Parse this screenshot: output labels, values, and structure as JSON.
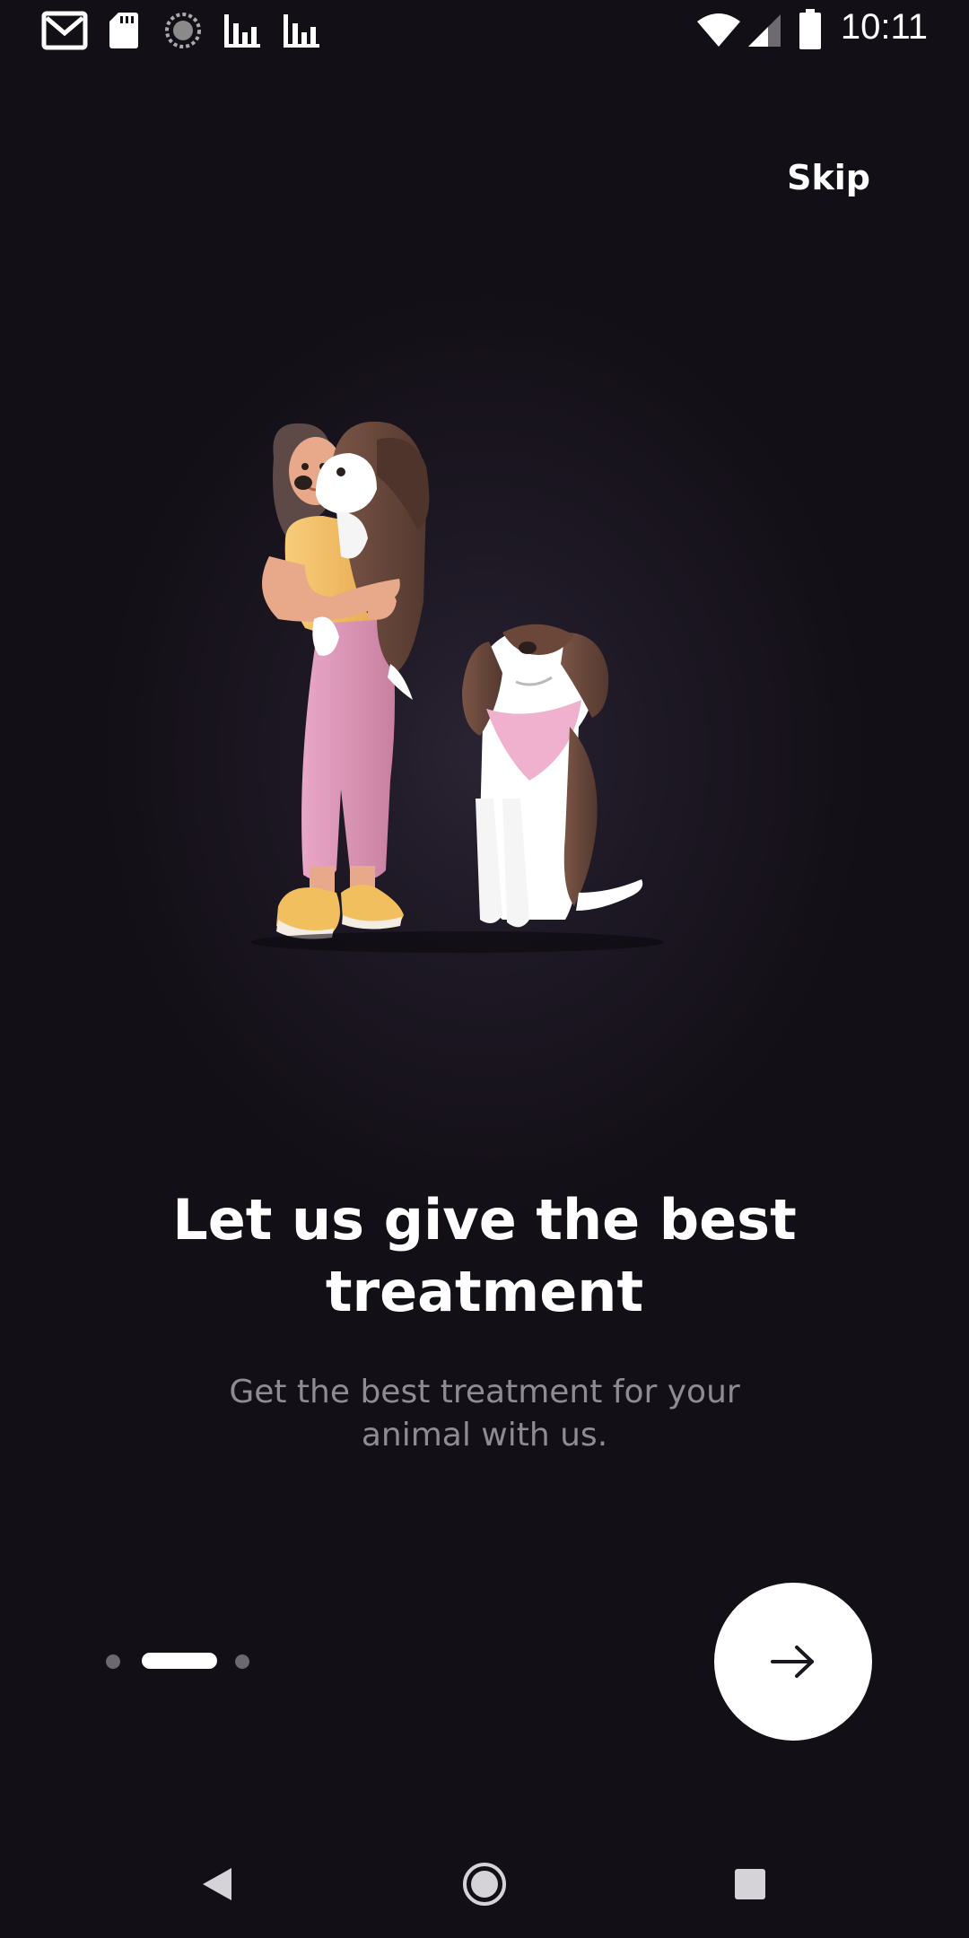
{
  "status_bar": {
    "time": "10:11",
    "left_icons": [
      "gmail-icon",
      "sd-card-icon",
      "sync-icon",
      "bar-chart-icon",
      "bar-chart-icon"
    ],
    "right_icons": [
      "wifi-icon",
      "cell-signal-icon",
      "battery-icon"
    ]
  },
  "onboarding": {
    "skip_label": "Skip",
    "title": "Let us give the best treatment",
    "subtitle": "Get the best treatment for your animal with us.",
    "page_indicator": {
      "total": 3,
      "active_index": 1
    },
    "next_icon": "arrow-right-icon"
  },
  "navigation_bar": {
    "buttons": [
      "back-icon",
      "home-icon",
      "recents-icon"
    ]
  },
  "colors": {
    "background": "#130f16",
    "glow": "#2a2333",
    "text_primary": "#ffffff",
    "text_secondary": "#8f8a94",
    "inactive_dot": "#6c6770",
    "button_bg": "#ffffff"
  }
}
